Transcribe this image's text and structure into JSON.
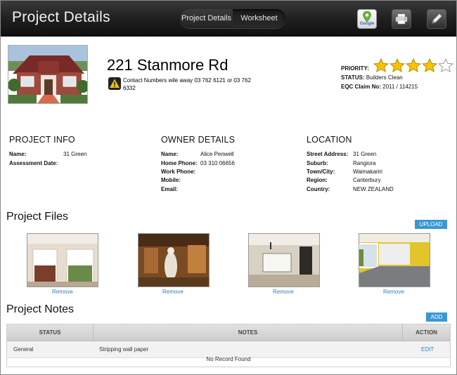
{
  "header": {
    "title": "Project Details",
    "segments": [
      {
        "label": "Project Details",
        "active": true
      },
      {
        "label": "Worksheet",
        "active": false
      }
    ],
    "tools": {
      "google_label": "Google",
      "google_icon": "google-maps-icon",
      "print_icon": "printer-icon",
      "edit_icon": "pencil-icon"
    }
  },
  "project": {
    "address": "221 Stanmore Rd",
    "contact_note": "Contact Numbers wile away 03 762 6121 or 03 762 6332",
    "priority_label": "PRIORITY:",
    "priority_stars_filled": 4,
    "priority_stars_total": 5,
    "status_label": "STATUS:",
    "status_value": "Builders Clean",
    "eqc_label": "EQC Claim No:",
    "eqc_value": "2011 / 114215"
  },
  "project_info": {
    "heading": "PROJECT INFO",
    "fields": [
      {
        "label": "Name:",
        "value": "31 Green"
      },
      {
        "label": "Assessment Date:",
        "value": ""
      }
    ]
  },
  "owner_details": {
    "heading": "OWNER DETAILS",
    "fields": [
      {
        "label": "Name:",
        "value": "Alice Penwell"
      },
      {
        "label": "Home Phone:",
        "value": "03 310 06656"
      },
      {
        "label": "Work Phone:",
        "value": ""
      },
      {
        "label": "Mobile:",
        "value": ""
      },
      {
        "label": "Email:",
        "value": ""
      }
    ]
  },
  "location": {
    "heading": "LOCATION",
    "fields": [
      {
        "label": "Street Address:",
        "value": "31 Green"
      },
      {
        "label": "Suburb:",
        "value": "Rangiora"
      },
      {
        "label": "Town/City:",
        "value": "Waimakariri"
      },
      {
        "label": "Region:",
        "value": "Canterbury"
      },
      {
        "label": "Country:",
        "value": "NEW ZEALAND"
      }
    ]
  },
  "files": {
    "title": "Project Files",
    "upload_label": "UPLOAD",
    "remove_label": "Remove"
  },
  "notes": {
    "title": "Project Notes",
    "add_label": "ADD",
    "columns": [
      "STATUS",
      "NOTES",
      "ACTION"
    ],
    "rows": [
      {
        "status": "General",
        "note": "Stripping wall paper",
        "action": "EDIT"
      }
    ],
    "empty_text": "No Record Found"
  },
  "colors": {
    "accent": "#3a97d6",
    "link": "#2a80c8",
    "star": "#f5c400"
  }
}
